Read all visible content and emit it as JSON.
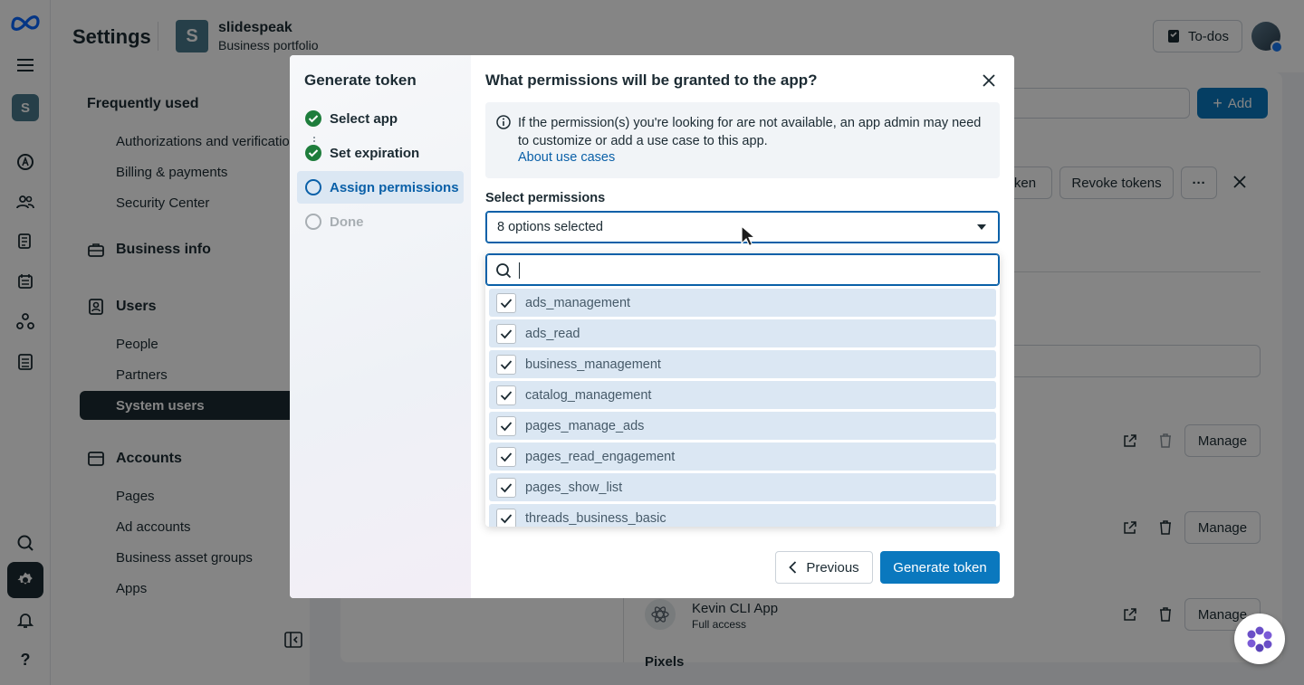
{
  "header": {
    "title": "Settings",
    "portfolio_initial": "S",
    "portfolio_name": "slidespeak",
    "portfolio_type": "Business portfolio",
    "todos_label": "To-dos"
  },
  "rail": {
    "account_initial": "S"
  },
  "sidebar": {
    "frequently_used": "Frequently used",
    "frequent_items": [
      "Authorizations and verifications",
      "Billing & payments",
      "Security Center"
    ],
    "business_info": "Business info",
    "users": "Users",
    "user_items": [
      "People",
      "Partners",
      "System users"
    ],
    "accounts": "Accounts",
    "account_items": [
      "Pages",
      "Ad accounts",
      "Business asset groups",
      "Apps"
    ]
  },
  "content": {
    "add_label": "Add",
    "token_btn_partial": "ken",
    "revoke_label": "Revoke tokens",
    "manage_label": "Manage",
    "app_name": "Kevin CLI App",
    "app_access": "Full access",
    "pixels_label": "Pixels"
  },
  "modal": {
    "left_title": "Generate token",
    "steps": [
      {
        "label": "Select app",
        "state": "done"
      },
      {
        "label": "Set expiration",
        "state": "done"
      },
      {
        "label": "Assign permissions",
        "state": "current"
      },
      {
        "label": "Done",
        "state": "todo"
      }
    ],
    "question": "What permissions will be granted to the app?",
    "info_text": "If the permission(s) you're looking for are not available, an app admin may need to customize or add a use case to this app.",
    "info_link": "About use cases",
    "select_label": "Select permissions",
    "select_value": "8 options selected",
    "options": [
      "ads_management",
      "ads_read",
      "business_management",
      "catalog_management",
      "pages_manage_ads",
      "pages_read_engagement",
      "pages_show_list",
      "threads_business_basic"
    ],
    "previous_label": "Previous",
    "generate_label": "Generate token"
  },
  "colors": {
    "primary": "#0a78be",
    "selected_row": "#dbe7f3",
    "dark": "#1c2b33",
    "done_green": "#1e7d3c"
  }
}
